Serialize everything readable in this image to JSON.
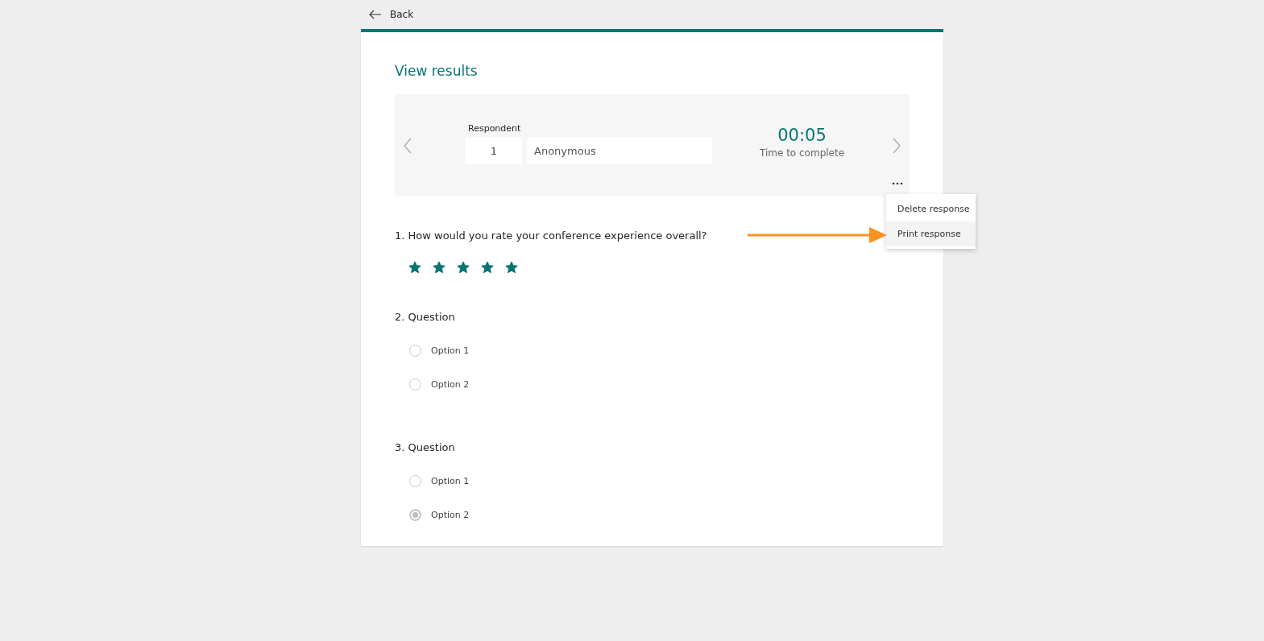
{
  "back": {
    "label": "Back"
  },
  "title": "View results",
  "respondent": {
    "label": "Respondent",
    "number": "1",
    "name": "Anonymous",
    "time": "00:05",
    "time_label": "Time to complete"
  },
  "menu": [
    {
      "label": "Delete response",
      "highlighted": false
    },
    {
      "label": "Print response",
      "highlighted": true
    }
  ],
  "questions": [
    {
      "kind": "rating",
      "title": "1. How would you rate your conference experience overall?",
      "stars": 5
    },
    {
      "kind": "choice",
      "title": "2. Question",
      "options": [
        {
          "label": "Option 1",
          "selected": false
        },
        {
          "label": "Option 2",
          "selected": false
        }
      ]
    },
    {
      "kind": "choice",
      "title": "3. Question",
      "options": [
        {
          "label": "Option 1",
          "selected": false
        },
        {
          "label": "Option 2",
          "selected": true
        }
      ]
    }
  ]
}
